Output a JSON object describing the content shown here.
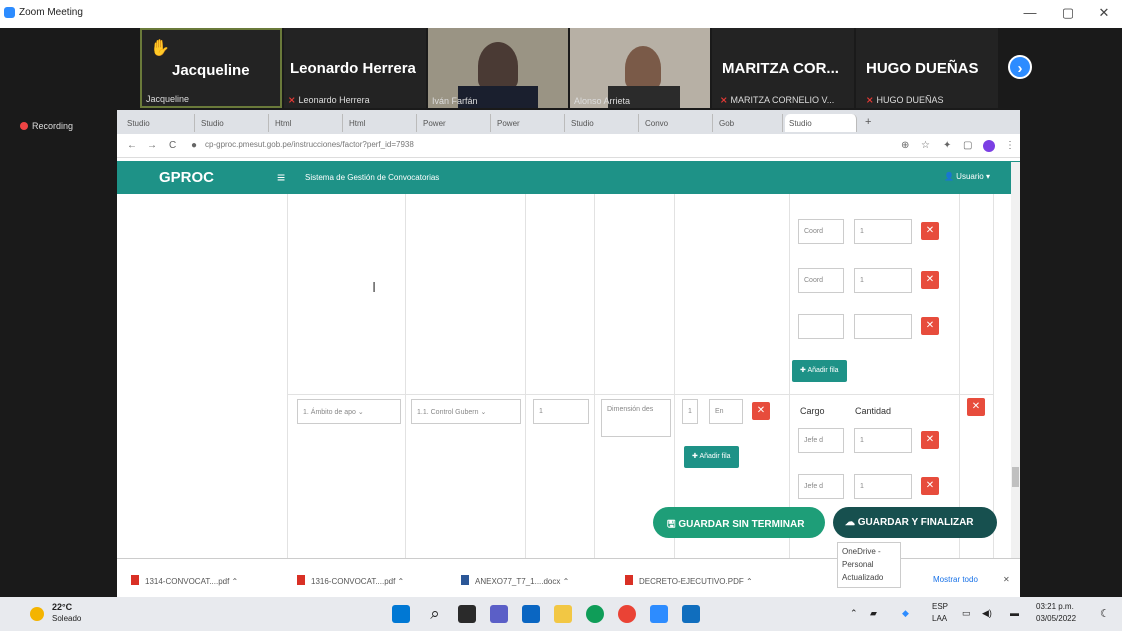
{
  "zoom": {
    "title": "Zoom Meeting",
    "controls": {
      "minimize": "—",
      "maximize": "▢",
      "close": "✕"
    },
    "participants": [
      {
        "name": "Jacqueline",
        "sub": "Jacqueline",
        "raised_hand": true
      },
      {
        "name": "Leonardo Herrera",
        "sub": "Leonardo Herrera",
        "muted": true
      },
      {
        "name": "",
        "sub": "Iván Farfán",
        "video": true
      },
      {
        "name": "",
        "sub": "Alonso Arrieta",
        "video": true
      },
      {
        "name": "MARITZA COR...",
        "sub": "MARITZA CORNELIO V...",
        "muted": true
      },
      {
        "name": "HUGO DUEÑAS",
        "sub": "HUGO DUEÑAS",
        "muted": true
      }
    ],
    "next_arrow": "›",
    "recording": "Recording"
  },
  "browser": {
    "tabs": [
      "Studio",
      "Studio",
      "Html",
      "Html",
      "Power",
      "Power",
      "Studio",
      "Convo",
      "Gob",
      "Studio"
    ],
    "url": "cp-gproc.pmesut.gob.pe/instrucciones/factor?perf_id=7938",
    "back": "←",
    "forward": "→",
    "reload": "C",
    "new_tab": "+"
  },
  "app": {
    "brand": "GPROC",
    "menu_icon": "≡",
    "system_name": "Sistema de Gestión de Convocatorias",
    "user": "Usuario",
    "rows_top": [
      {
        "cargo": "Coord",
        "cantidad": "1"
      },
      {
        "cargo": "Coord",
        "cantidad": "1"
      },
      {
        "cargo": "",
        "cantidad": ""
      }
    ],
    "add_row_label": "Añadir fila",
    "second_row": {
      "ambito": "1. Ámbito de apo",
      "control": "1.1. Control Gubern",
      "num": "1",
      "dimension": "Dimensión des",
      "qty": "1",
      "unit": "En",
      "headers": {
        "cargo": "Cargo",
        "cantidad": "Cantidad"
      },
      "rows": [
        {
          "cargo": "Jefe d",
          "cantidad": "1"
        },
        {
          "cargo": "Jefe d",
          "cantidad": "1"
        }
      ],
      "add_label": "Añadir fila"
    },
    "save_draft": "GUARDAR SIN TERMINAR",
    "save_final": "GUARDAR Y FINALIZAR",
    "note_lines": [
      "OneDrive -",
      "Personal",
      "Actualizado"
    ]
  },
  "downloads": {
    "items": [
      "1314-CONVOCAT....pdf",
      "1316-CONVOCAT....pdf",
      "ANEXO77_T7_1....docx",
      "DECRETO-EJECUTIVO.PDF"
    ],
    "show_all": "Mostrar todo"
  },
  "taskbar": {
    "weather_temp": "22°C",
    "weather_desc": "Soleado",
    "lang1": "ESP",
    "lang2": "LAA",
    "time": "03:21 p.m.",
    "date": "03/05/2022"
  },
  "colors": {
    "teal": "#1e9287",
    "danger": "#e74c3c",
    "zoom_blue": "#2d8cff",
    "dark_teal": "#17504f"
  }
}
